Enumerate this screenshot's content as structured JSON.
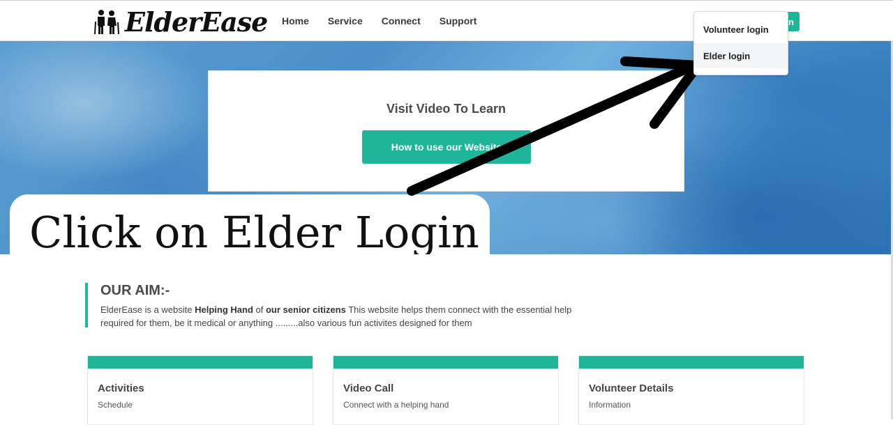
{
  "brand": {
    "name": "ElderEase"
  },
  "nav": {
    "home": "Home",
    "service": "Service",
    "connect": "Connect",
    "support": "Support"
  },
  "login_button": {
    "label": "n"
  },
  "dropdown": {
    "volunteer": "Volunteer login",
    "elder": "Elder login"
  },
  "hero": {
    "title": "Visit Video To Learn",
    "button": "How to use our Website"
  },
  "caption": "Click on Elder Login",
  "aim": {
    "title": "OUR AIM:-",
    "intro": "ElderEase is a website ",
    "bold1": "Helping Hand",
    "mid": " of ",
    "bold2": "our senior citizens",
    "rest": " This website helps them connect with the essential help required for them, be it medical or anything .........also various fun activites designed for them"
  },
  "cards": [
    {
      "title": "Activities",
      "subtitle": "Schedule"
    },
    {
      "title": "Video Call",
      "subtitle": "Connect with a helping hand"
    },
    {
      "title": "Volunteer Details",
      "subtitle": "Information"
    }
  ],
  "colors": {
    "accent": "#1fb59a",
    "hero_blue": "#4c90c9",
    "arrow": "#000000"
  },
  "icons": {
    "logo": "elderly-couple-icon",
    "annotation": "arrow-icon"
  }
}
